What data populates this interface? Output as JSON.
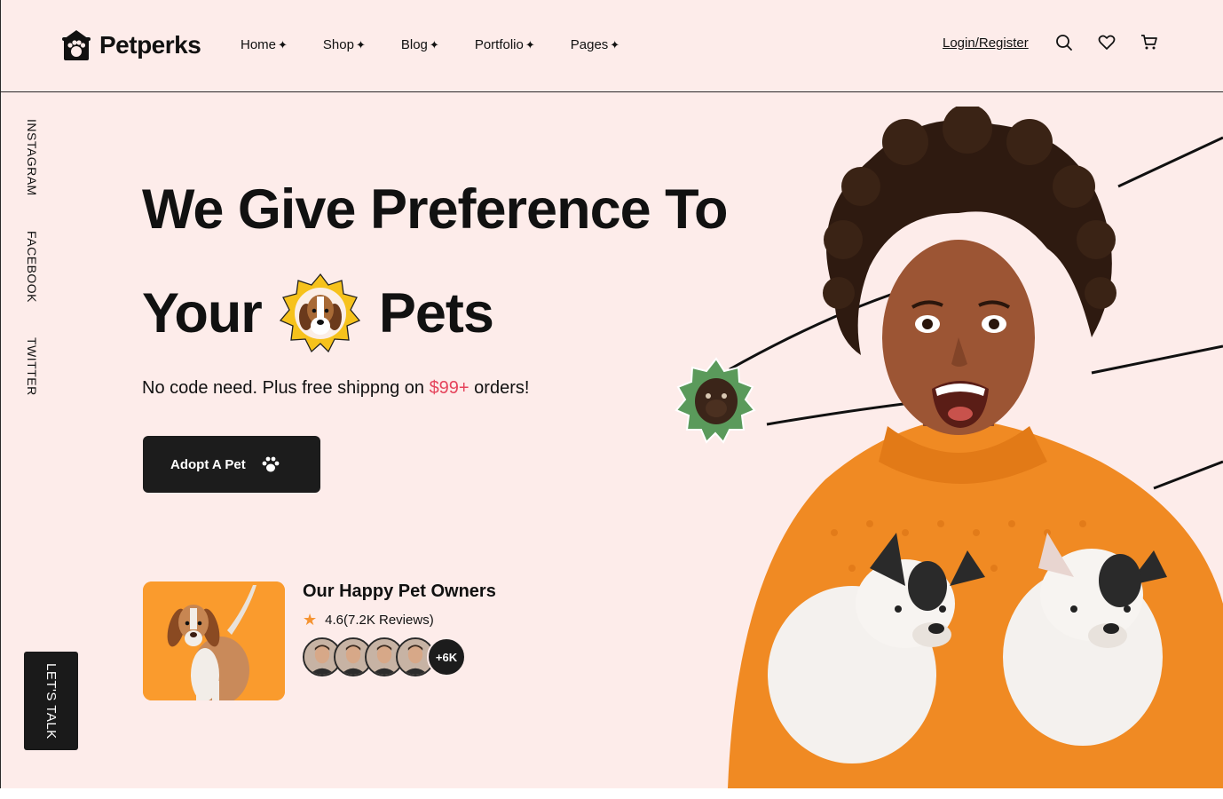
{
  "brand": {
    "name": "Petperks"
  },
  "nav": {
    "items": [
      {
        "label": "Home",
        "spark": "✦"
      },
      {
        "label": "Shop",
        "spark": "✦"
      },
      {
        "label": "Blog",
        "spark": "✦"
      },
      {
        "label": "Portfolio",
        "spark": "✦"
      },
      {
        "label": "Pages",
        "spark": "✦"
      }
    ]
  },
  "header": {
    "login_label": "Login/Register",
    "icons": [
      "search-icon",
      "heart-icon",
      "cart-icon"
    ]
  },
  "social": {
    "instagram": "INSTAGRAM",
    "facebook": "FACEBOOK",
    "twitter": "TWITTER"
  },
  "hero": {
    "title_line1": "We Give Preference To",
    "title_word_left": "Your",
    "title_word_right": "Pets",
    "subtitle_pre": "No code need. Plus free shippng on ",
    "subtitle_price": "$99+",
    "subtitle_post": " orders!",
    "cta_label": "Adopt A Pet"
  },
  "owners": {
    "title": "Our Happy Pet Owners",
    "rating": "4.6(7.2K Reviews)",
    "more_count": "+6K"
  },
  "floating": {
    "lets_talk": "LET'S TALK"
  },
  "colors": {
    "background": "#fdecea",
    "accent_price": "#e5435b",
    "button": "#1c1c1c",
    "orange": "#fa9b2d",
    "green_badge": "#5a9a5b"
  }
}
